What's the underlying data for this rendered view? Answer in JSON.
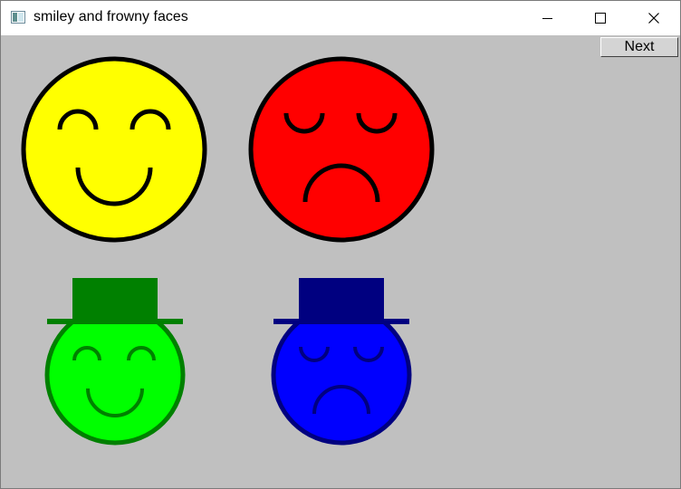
{
  "window": {
    "title": "smiley and frowny faces",
    "background": "#c0c0c0"
  },
  "titlebar": {
    "app_icon": "window-app-icon",
    "controls": [
      "minimize-icon",
      "maximize-icon",
      "close-icon"
    ]
  },
  "toolbar": {
    "next_label": "Next"
  },
  "faces": [
    {
      "name": "yellow-smiley-face",
      "mood": "smiley",
      "hat": false,
      "fill": "#ffff00",
      "outline": "#000000"
    },
    {
      "name": "red-frowny-face",
      "mood": "frowny",
      "hat": false,
      "fill": "#ff0000",
      "outline": "#000000"
    },
    {
      "name": "green-smiley-face-with-hat",
      "mood": "smiley",
      "hat": true,
      "fill": "#00ff00",
      "outline": "#008000"
    },
    {
      "name": "blue-frowny-face-with-hat",
      "mood": "frowny",
      "hat": true,
      "fill": "#0000ff",
      "outline": "#000080"
    }
  ]
}
